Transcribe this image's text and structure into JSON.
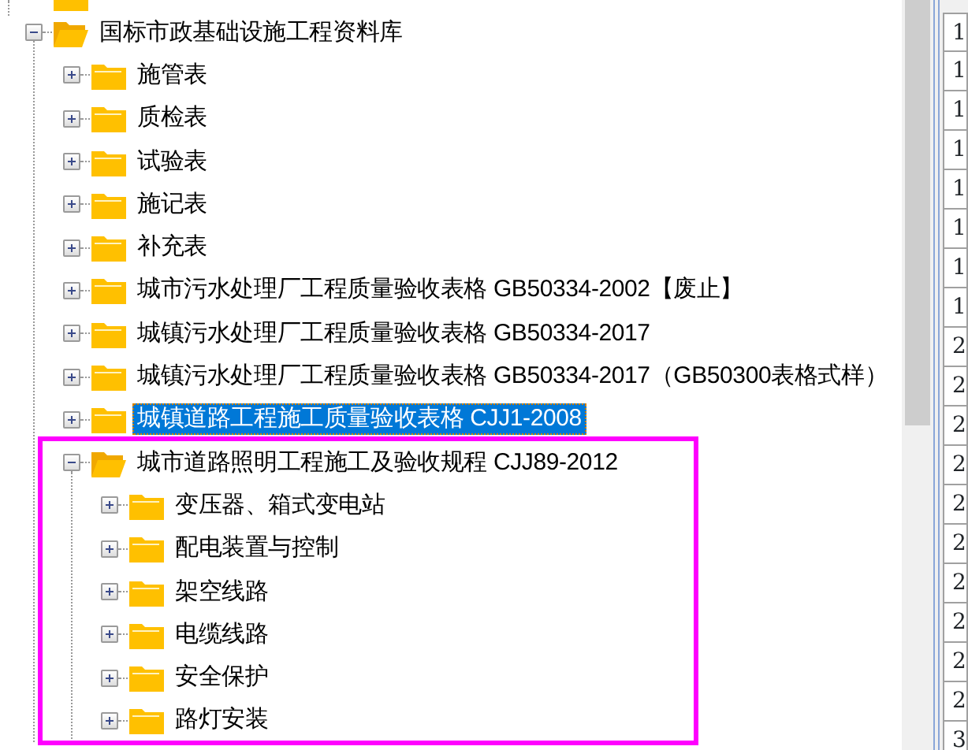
{
  "tree": [
    {
      "label": "国标市政基础设施工程资料库",
      "expanded": true,
      "selected": false,
      "children": [
        {
          "label": "施管表",
          "expanded": false,
          "selected": false
        },
        {
          "label": "质检表",
          "expanded": false,
          "selected": false
        },
        {
          "label": "试验表",
          "expanded": false,
          "selected": false
        },
        {
          "label": "施记表",
          "expanded": false,
          "selected": false
        },
        {
          "label": "补充表",
          "expanded": false,
          "selected": false
        },
        {
          "label": "城市污水处理厂工程质量验收表格 GB50334-2002【废止】",
          "expanded": false,
          "selected": false
        },
        {
          "label": "城镇污水处理厂工程质量验收表格 GB50334-2017",
          "expanded": false,
          "selected": false
        },
        {
          "label": "城镇污水处理厂工程质量验收表格 GB50334-2017（GB50300表格式样）",
          "expanded": false,
          "selected": false
        },
        {
          "label": "城镇道路工程施工质量验收表格 CJJ1-2008",
          "expanded": false,
          "selected": true
        },
        {
          "label": "城市道路照明工程施工及验收规程 CJJ89-2012",
          "expanded": true,
          "selected": false,
          "children": [
            {
              "label": "变压器、箱式变电站",
              "expanded": false,
              "selected": false
            },
            {
              "label": "配电装置与控制",
              "expanded": false,
              "selected": false
            },
            {
              "label": "架空线路",
              "expanded": false,
              "selected": false
            },
            {
              "label": "电缆线路",
              "expanded": false,
              "selected": false
            },
            {
              "label": "安全保护",
              "expanded": false,
              "selected": false
            },
            {
              "label": "路灯安装",
              "expanded": false,
              "selected": false
            }
          ]
        }
      ]
    }
  ],
  "side_column": [
    "1",
    "1",
    "1",
    "1",
    "1",
    "1",
    "1",
    "1",
    "2",
    "2",
    "2",
    "2",
    "2",
    "2",
    "2",
    "2",
    "2",
    "2",
    "3"
  ]
}
